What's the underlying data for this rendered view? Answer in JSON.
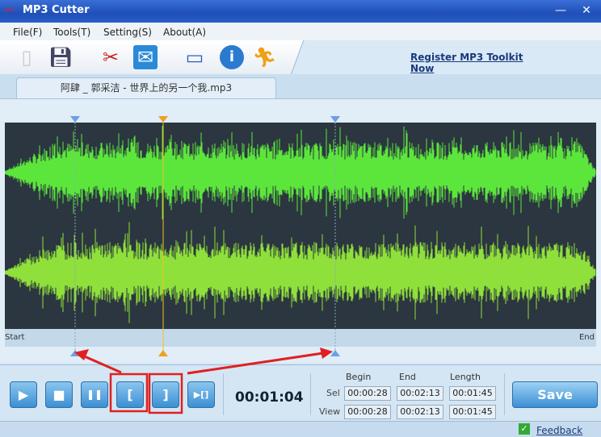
{
  "window": {
    "title": "MP3 Cutter",
    "minimize": "—",
    "close": "✕"
  },
  "menu": [
    {
      "label": "File(F)"
    },
    {
      "label": "Tools(T)"
    },
    {
      "label": "Setting(S)"
    },
    {
      "label": "About(A)"
    }
  ],
  "toolbar": {
    "icons": [
      "new-file-icon",
      "save-icon",
      "cut-icon",
      "email-icon",
      "monitor-icon",
      "info-icon",
      "runner-icon"
    ],
    "register_link": "Register MP3 Toolkit Now"
  },
  "tab": {
    "label": "阿肆 _ 郭采洁 - 世界上的另一个我.mp3"
  },
  "wave": {
    "background": "#2b3640",
    "top_color": "#5ce63c",
    "bottom_color": "#8fe03a",
    "ruler_start": "Start",
    "ruler_end": "End",
    "markers": {
      "sel_begin": "00:00:28",
      "playhead": "00:01:04",
      "sel_end": "00:02:13"
    }
  },
  "controls": {
    "time": "00:01:04",
    "play": "▶",
    "stop": "■",
    "pause": "❚❚",
    "mark_begin": "[",
    "mark_end": "]",
    "play_selection": "▶[]",
    "save": "Save"
  },
  "selection": {
    "headers": [
      "Begin",
      "End",
      "Length"
    ],
    "rows": [
      {
        "label": "Sel",
        "begin": "00:00:28",
        "end": "00:02:13",
        "length": "00:01:45"
      },
      {
        "label": "View",
        "begin": "00:00:28",
        "end": "00:02:13",
        "length": "00:01:45"
      }
    ]
  },
  "status": {
    "feedback": "Feedback"
  }
}
